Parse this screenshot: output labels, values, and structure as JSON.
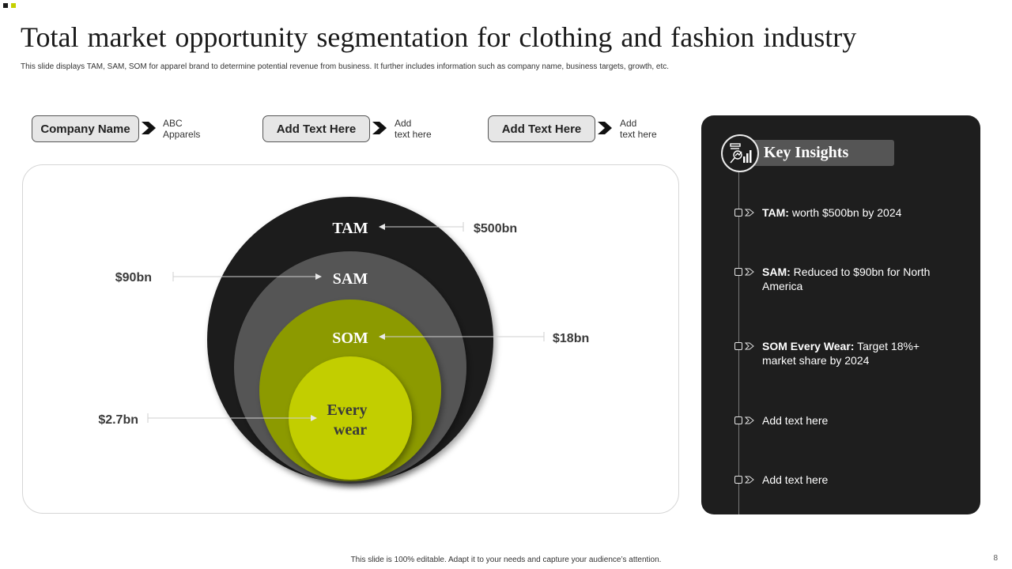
{
  "slide": {
    "title": "Total market opportunity segmentation for clothing and fashion industry",
    "subtitle": "This slide displays TAM, SAM, SOM  for apparel brand to determine potential revenue from business. It further includes information such as company name,  business targets, growth, etc.",
    "footer": "This slide is 100% editable.  Adapt it to your needs and capture your audience’s attention.",
    "page_number": "8"
  },
  "top_row": [
    {
      "label": "Company Name",
      "text": "ABC\nApparels"
    },
    {
      "label": "Add  Text Here",
      "text": "Add\ntext here"
    },
    {
      "label": "Add  Text Here",
      "text": "Add\ntext here"
    }
  ],
  "diagram": {
    "circles": [
      {
        "name": "TAM",
        "value": "$500bn",
        "color": "#1c1c1c",
        "label_color": "#ffffff"
      },
      {
        "name": "SAM",
        "value": "$90bn",
        "color": "#555555",
        "label_color": "#ffffff"
      },
      {
        "name": "SOM",
        "value": "$18bn",
        "color": "#8c9a00",
        "label_color": "#ffffff"
      },
      {
        "name": "Every wear",
        "name_line1": "Every",
        "name_line2": "wear",
        "value": "$2.7bn",
        "color": "#c2ce06",
        "label_color": "#3a3a3a"
      }
    ]
  },
  "insights": {
    "title": "Key Insights",
    "icon": "analytics-icon",
    "items": [
      {
        "bold": "TAM:",
        "text": " worth $500bn by 2024"
      },
      {
        "bold": "SAM:",
        "text": " Reduced to $90bn for North America"
      },
      {
        "bold": "SOM Every Wear:",
        "text": " Target 18%+ market share by 2024"
      },
      {
        "bold": "",
        "text": "Add text here"
      },
      {
        "bold": "",
        "text": "Add text here"
      }
    ]
  },
  "colors": {
    "accent_lime": "#c5d000",
    "accent_olive": "#8c9a00",
    "dark": "#1e1e1e",
    "gray": "#555555"
  }
}
